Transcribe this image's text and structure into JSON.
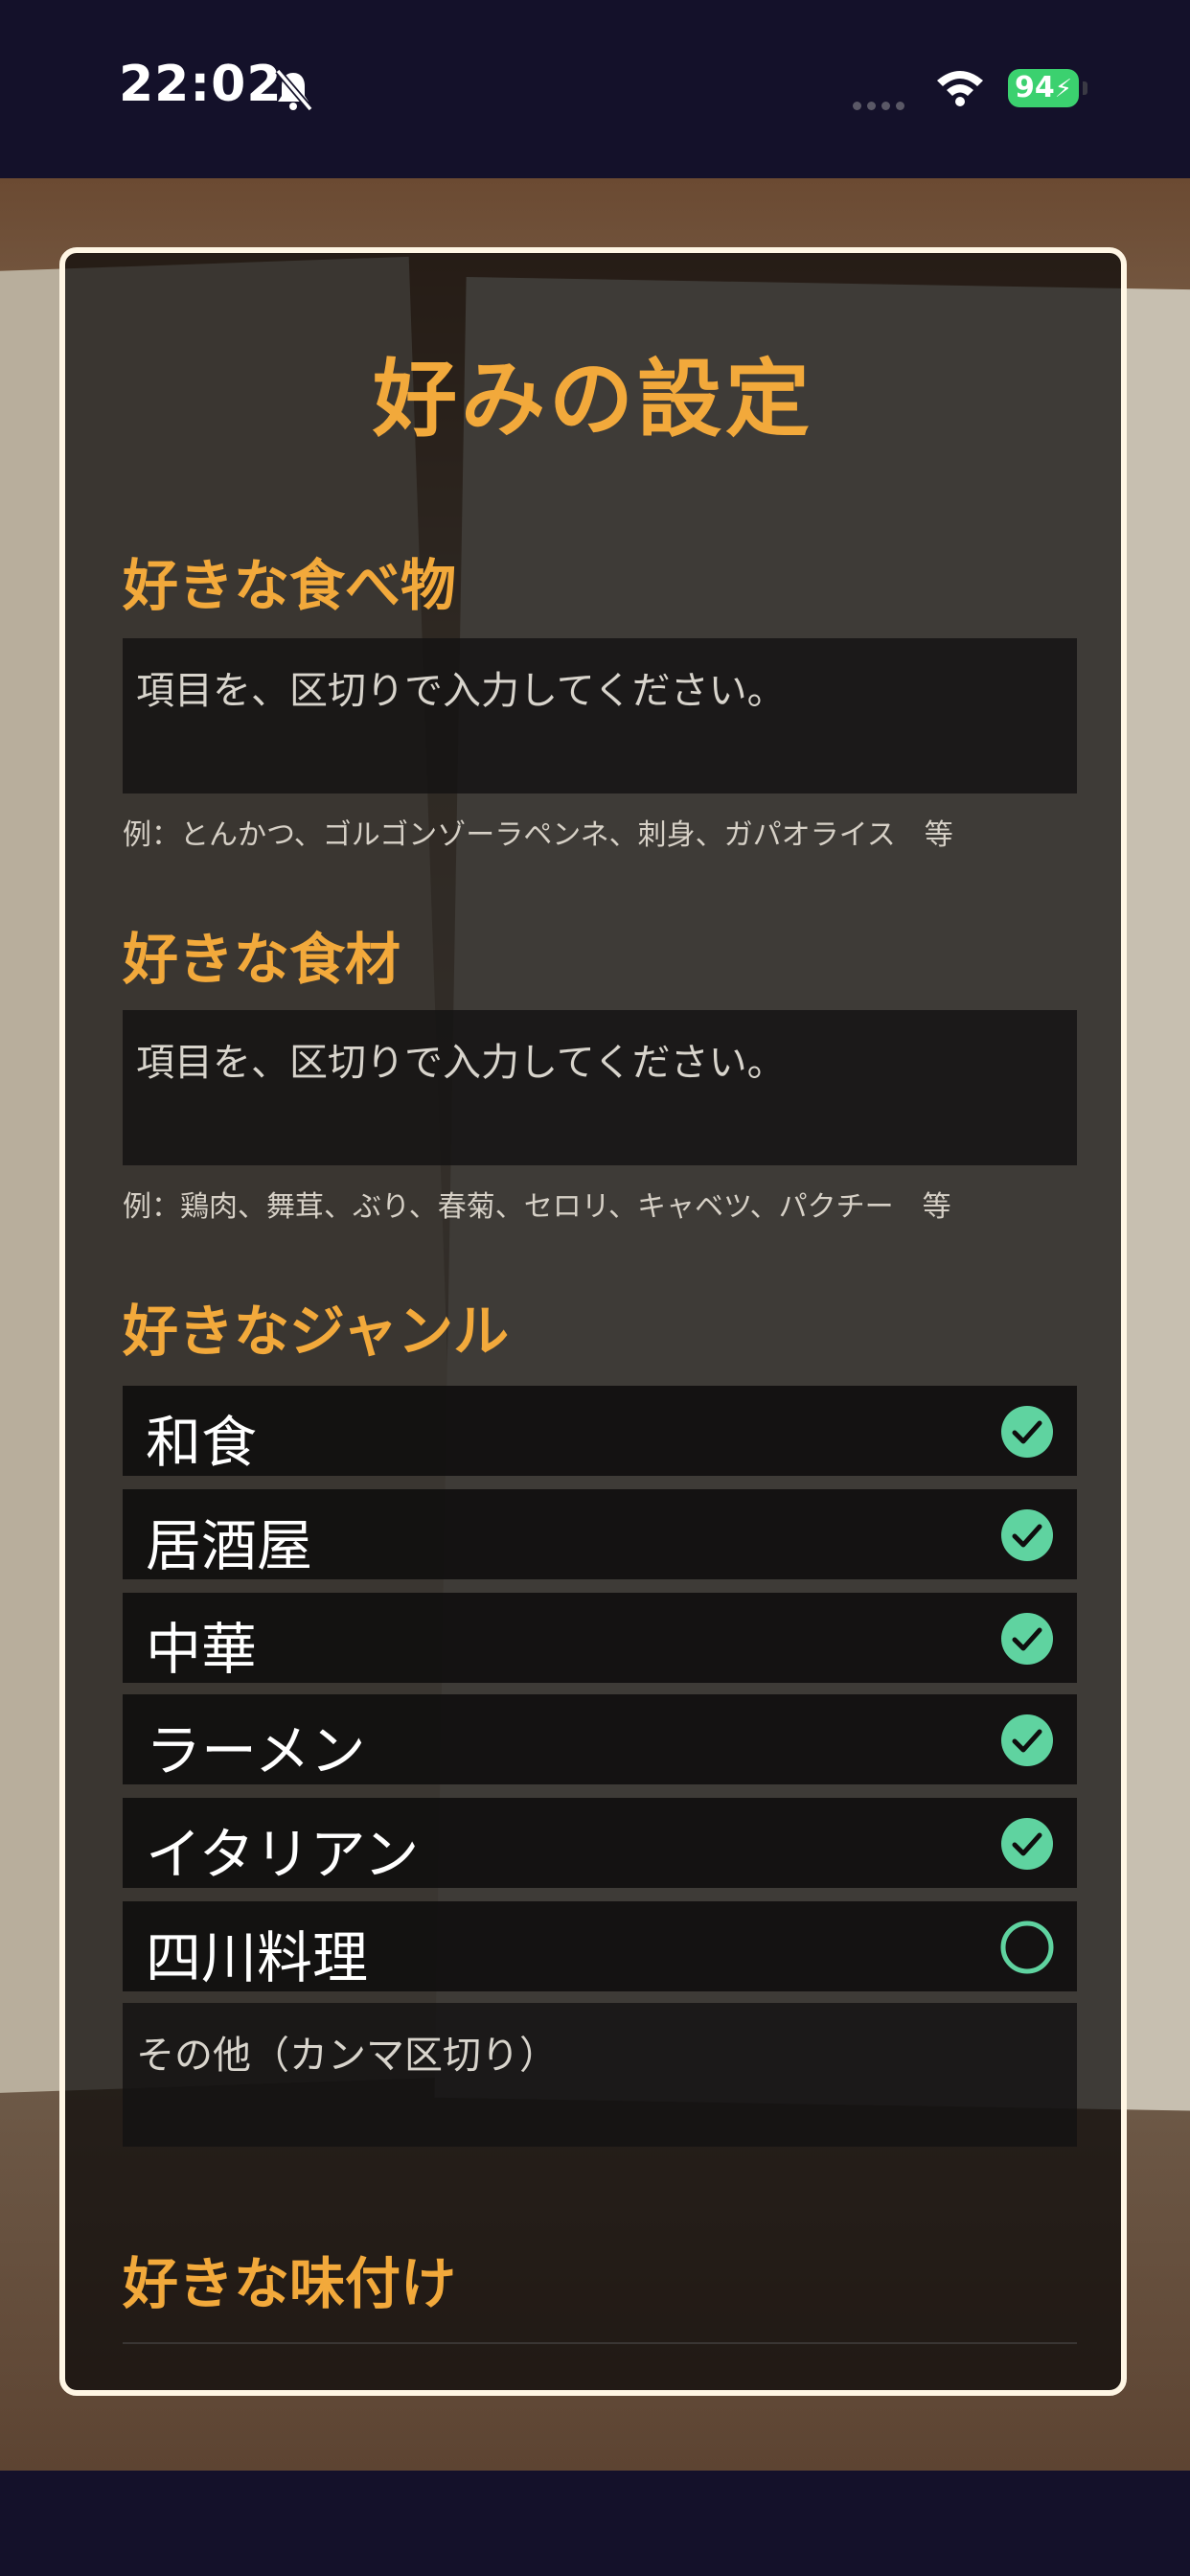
{
  "status_bar": {
    "time": "22:02",
    "battery": "94"
  },
  "modal": {
    "title": "好みの設定",
    "foods": {
      "title": "好きな食べ物",
      "placeholder": "項目を、区切りで入力してください。",
      "hint": "例：とんかつ、ゴルゴンゾーラペンネ、刺身、ガパオライス　等"
    },
    "ingredients": {
      "title": "好きな食材",
      "placeholder": "項目を、区切りで入力してください。",
      "hint": "例：鶏肉、舞茸、ぶり、春菊、セロリ、キャベツ、パクチー　等"
    },
    "genres": {
      "title": "好きなジャンル",
      "items": [
        {
          "label": "和食",
          "checked": true
        },
        {
          "label": "居酒屋",
          "checked": true
        },
        {
          "label": "中華",
          "checked": true
        },
        {
          "label": "ラーメン",
          "checked": true
        },
        {
          "label": "イタリアン",
          "checked": true
        },
        {
          "label": "四川料理",
          "checked": false
        }
      ],
      "other_placeholder": "その他（カンマ区切り）"
    },
    "seasoning": {
      "title": "好きな味付け"
    }
  },
  "colors": {
    "accent": "#f2a93b",
    "check": "#5fd3a0",
    "border": "#fff6e4"
  }
}
